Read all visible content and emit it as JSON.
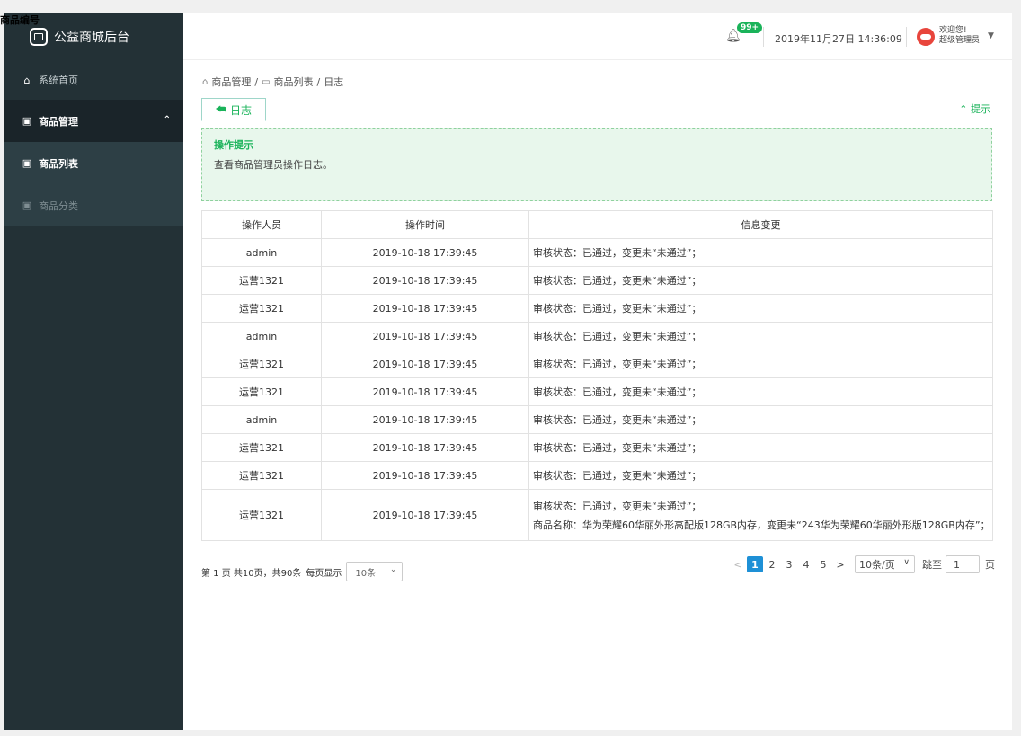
{
  "overlay_title": "商品编号",
  "app": {
    "title": "公益商城后台"
  },
  "sidebar": {
    "items": [
      {
        "label": "系统首页",
        "icon": "home-icon"
      },
      {
        "label": "商品管理",
        "icon": "shop-icon"
      },
      {
        "label": "商品列表",
        "icon": "shop-icon"
      },
      {
        "label": "商品分类",
        "icon": "shop-icon"
      }
    ]
  },
  "header": {
    "badge": "99+",
    "datetime": "2019年11月27日 14:36:09",
    "welcome": "欢迎您!",
    "role": "超级管理员"
  },
  "breadcrumb": [
    "商品管理",
    "商品列表",
    "日志"
  ],
  "tab": {
    "label": "日志"
  },
  "hint_toggle": "提示",
  "tip": {
    "title": "操作提示",
    "text": "查看商品管理员操作日志。"
  },
  "table": {
    "headers": [
      "操作人员",
      "操作时间",
      "信息变更"
    ],
    "rows": [
      {
        "operator": "admin",
        "time": "2019-10-18 17:39:45",
        "change": "审核状态：已通过，变更未“未通过”；"
      },
      {
        "operator": "运营1321",
        "time": "2019-10-18 17:39:45",
        "change": "审核状态：已通过，变更未“未通过”；"
      },
      {
        "operator": "运营1321",
        "time": "2019-10-18 17:39:45",
        "change": "审核状态：已通过，变更未“未通过”；"
      },
      {
        "operator": "admin",
        "time": "2019-10-18 17:39:45",
        "change": "审核状态：已通过，变更未“未通过”；"
      },
      {
        "operator": "运营1321",
        "time": "2019-10-18 17:39:45",
        "change": "审核状态：已通过，变更未“未通过”；"
      },
      {
        "operator": "运营1321",
        "time": "2019-10-18 17:39:45",
        "change": "审核状态：已通过，变更未“未通过”；"
      },
      {
        "operator": "admin",
        "time": "2019-10-18 17:39:45",
        "change": "审核状态：已通过，变更未“未通过”；"
      },
      {
        "operator": "运营1321",
        "time": "2019-10-18 17:39:45",
        "change": "审核状态：已通过，变更未“未通过”；"
      },
      {
        "operator": "运营1321",
        "time": "2019-10-18 17:39:45",
        "change": "审核状态：已通过，变更未“未通过”；"
      },
      {
        "operator": "运营1321",
        "time": "2019-10-18 17:39:45",
        "change": "审核状态：已通过，变更未“未通过”；",
        "change2": "商品名称：华为荣耀60华丽外形高配版128GB内存，变更未“243华为荣耀60华丽外形版128GB内存”；"
      }
    ]
  },
  "footer": {
    "summary": "第 1 页 共10页，共90条",
    "per_page_label": "每页显示",
    "per_page_value": "10条"
  },
  "pager": {
    "prev": "<",
    "pages": [
      "1",
      "2",
      "3",
      "4",
      "5"
    ],
    "next": ">",
    "size": "10条/页",
    "jump_label": "跳至",
    "jump_value": "1",
    "page_suffix": "页"
  },
  "colors": {
    "sidebar": "#233136",
    "accent": "#1ab35a",
    "pager_active": "#1e90d6"
  }
}
